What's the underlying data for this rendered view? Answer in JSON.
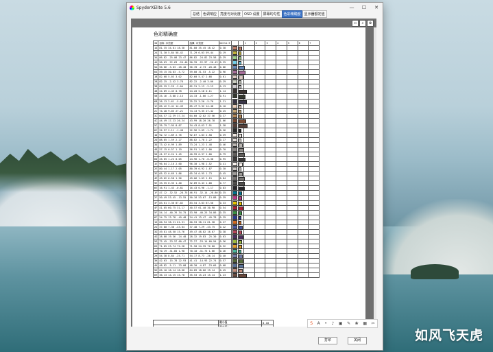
{
  "window": {
    "title": "SpyderXElite 5.6",
    "controls": [
      "—",
      "☐",
      "✕"
    ]
  },
  "tabs": [
    "总结",
    "色调响应",
    "亮度与对比度",
    "OSD 设置",
    "屏幕均匀性",
    "色彩精确度",
    "显示器额定值"
  ],
  "active_tab": 5,
  "report": {
    "title": "色彩精确度",
    "headers": [
      "ID",
      "目标 示范室",
      "结果 示范室",
      "Delta E",
      "",
      "",
      "1",
      "2",
      "3",
      "4",
      "5",
      "6",
      "7"
    ],
    "rows": [
      {
        "id": "1A",
        "target": "81.35  34.81  18.38",
        "result": "81.80  35.45  18.42",
        "de": "0.38",
        "color": "#c0806b",
        "bar": 0.05
      },
      {
        "id": "2A",
        "target": "71.30  5.84  58.42",
        "result": "71.29  6.03  59.44",
        "de": "0.19",
        "color": "#c1b13c",
        "bar": 0.03
      },
      {
        "id": "3A",
        "target": "86.82 -25.08  23.47",
        "result": "86.82 -24.82  23.58",
        "de": "0.29",
        "color": "#9ed08b",
        "bar": 0.04
      },
      {
        "id": "4A",
        "target": "90.63 -22.63 -26.40",
        "result": "90.39 -22.97 -26.43",
        "de": "0.25",
        "color": "#74d0e8",
        "bar": 0.04
      },
      {
        "id": "5A",
        "target": "56.66 -3.03 -28.40",
        "result": "56.78 -2.73 -28.48",
        "de": "0.86",
        "color": "#6a8ab7",
        "bar": 0.12
      },
      {
        "id": "6A",
        "target": "59.15  30.83 -5.72",
        "result": "59.00  31.53 -5.22",
        "de": "0.96",
        "color": "#a86f9b",
        "bar": 0.13
      },
      {
        "id": "1B",
        "target": "82.68  5.03  3.02",
        "result": "82.60  5.47  2.68",
        "de": "0.61",
        "color": "#dcc9c2",
        "bar": 0.09
      },
      {
        "id": "2B",
        "target": "82.25 -2.42  3.78",
        "result": "82.22 -2.40  3.06",
        "de": "0.29",
        "color": "#cccfc2",
        "bar": 0.04
      },
      {
        "id": "3B",
        "target": "82.29  2.29 -2.04",
        "result": "82.31  2.13 -2.13",
        "de": "0.13",
        "color": "#d0ccd0",
        "bar": 0.02
      },
      {
        "id": "4B",
        "target": "24.89  4.43  0.78",
        "result": "24.20  5.18  0.11",
        "de": "1.14",
        "color": "#3e3634",
        "bar": 0.16
      },
      {
        "id": "5B",
        "target": "25.16 -3.88  2.13",
        "result": "24.33 -1.66  1.27",
        "de": "0.91",
        "color": "#35392f",
        "bar": 0.13
      },
      {
        "id": "6B",
        "target": "26.13  2.61 -5.03",
        "result": "25.22  3.20 -5.70",
        "de": "1.21",
        "color": "#3a3648",
        "bar": 0.17
      },
      {
        "id": "1C",
        "target": "85.42  9.41  14.49",
        "result": "85.47  9.32  14.48",
        "de": "0.10",
        "color": "#e8cdb8",
        "bar": 0.02
      },
      {
        "id": "2C",
        "target": "74.28  9.05  27.21",
        "result": "74.13  9.35  27.42",
        "de": "0.25",
        "color": "#c7a878",
        "bar": 0.04
      },
      {
        "id": "3C",
        "target": "64.57  12.39  37.24",
        "result": "64.60  12.02  37.56",
        "de": "0.37",
        "color": "#b78a5a",
        "bar": 0.05
      },
      {
        "id": "4C",
        "target": "44.49  17.23  26.24",
        "result": "43.99  18.20  26.78",
        "de": "1.06",
        "color": "#7a4a34",
        "bar": 0.15
      },
      {
        "id": "5C",
        "target": "35.79  7.95  8.87",
        "result": "34.43  8.63  7.91",
        "de": "1.38",
        "color": "#56403a",
        "bar": 0.19
      },
      {
        "id": "6C",
        "target": "22.97  2.11 -1.48",
        "result": "22.96  2.09 -1.74",
        "de": "0.26",
        "color": "#2c2b2c",
        "bar": 0.04
      },
      {
        "id": "1D",
        "target": "92.72  1.89  2.76",
        "result": "92.67  1.83  2.58",
        "de": "0.39",
        "color": "#efe8e3",
        "bar": 0.05
      },
      {
        "id": "2D",
        "target": "88.85  1.59  2.27",
        "result": "88.82  1.78  2.22",
        "de": "0.27",
        "color": "#e2ddd9",
        "bar": 0.04
      },
      {
        "id": "3D",
        "target": "73.42  0.99  1.89",
        "result": "73.24  1.23  1.48",
        "de": "0.46",
        "color": "#bcb7b3",
        "bar": 0.07
      },
      {
        "id": "4D",
        "target": "57.15  0.57  1.19",
        "result": "56.91  1.02  1.00",
        "de": "0.70",
        "color": "#8d8986",
        "bar": 0.1
      },
      {
        "id": "5D",
        "target": "41.57  0.24  1.45",
        "result": "40.99  0.37  1.00",
        "de": "0.79",
        "color": "#625f5d",
        "bar": 0.11
      },
      {
        "id": "6D",
        "target": "25.65  1.24  0.05",
        "result": "24.96  1.70 -0.38",
        "de": "0.95",
        "color": "#3c3a3a",
        "bar": 0.13
      },
      {
        "id": "1E",
        "target": "96.04  2.16  2.60",
        "result": "96.30  1.98  2.52",
        "de": "0.41",
        "color": "#faf3ee",
        "bar": 0.06
      },
      {
        "id": "2E",
        "target": "80.44  1.17  2.05",
        "result": "80.39  0.92  1.87",
        "de": "0.30",
        "color": "#cbc7c3",
        "bar": 0.04
      },
      {
        "id": "3E",
        "target": "65.52  0.69  1.86",
        "result": "65.34  0.95  1.73",
        "de": "0.45",
        "color": "#a09d9a",
        "bar": 0.06
      },
      {
        "id": "4E",
        "target": "49.62  0.58  1.56",
        "result": "49.06  1.03  1.15",
        "de": "0.84",
        "color": "#777472",
        "bar": 0.12
      },
      {
        "id": "5E",
        "target": "33.55  0.35  1.40",
        "result": "32.89  0.43  1.00",
        "de": "0.77",
        "color": "#514f4d",
        "bar": 0.11
      },
      {
        "id": "6E",
        "target": "16.91  1.43 -0.81",
        "result": "16.43  0.96 -1.17",
        "de": "0.83",
        "color": "#282629",
        "bar": 0.12
      },
      {
        "id": "1F",
        "target": "47.12 -32.52 -28.75",
        "result": "46.91 -32.14 -28.80",
        "de": "0.35",
        "color": "#00748f",
        "bar": 0.05
      },
      {
        "id": "2F",
        "target": "50.49  53.45 -13.55",
        "result": "50.18  53.67 -13.88",
        "de": "0.39",
        "color": "#bb3a8a",
        "bar": 0.05
      },
      {
        "id": "3F",
        "target": "83.61  3.36  87.02",
        "result": "83.54  3.83  87.50",
        "de": "0.33",
        "color": "#e8c600",
        "bar": 0.05
      },
      {
        "id": "4F",
        "target": "41.05  60.75  31.17",
        "result": "40.57  61.40  30.90",
        "de": "0.54",
        "color": "#ad2237",
        "bar": 0.08
      },
      {
        "id": "5F",
        "target": "54.14 -40.76  34.75",
        "result": "53.90 -40.25  34.86",
        "de": "0.35",
        "color": "#3b9244",
        "bar": 0.05
      },
      {
        "id": "6F",
        "target": "24.75  13.78 -49.48",
        "result": "24.41  13.47 -49.78",
        "de": "0.29",
        "color": "#2c3a8c",
        "bar": 0.04
      },
      {
        "id": "1G",
        "target": "60.94  38.21  61.31",
        "result": "60.53  38.11  61.38",
        "de": "0.27",
        "color": "#d46b1f",
        "bar": 0.04
      },
      {
        "id": "2G",
        "target": "37.80  7.30 -43.04",
        "result": "37.48  7.29 -43.75",
        "de": "0.42",
        "color": "#4c5aa3",
        "bar": 0.06
      },
      {
        "id": "3G",
        "target": "49.81  48.50  15.76",
        "result": "49.47  48.82  16.07",
        "de": "0.38",
        "color": "#b9475c",
        "bar": 0.05
      },
      {
        "id": "4G",
        "target": "28.88  19.36 -24.48",
        "result": "28.32  19.83 -25.30",
        "de": "0.63",
        "color": "#4e2f60",
        "bar": 0.09
      },
      {
        "id": "5G",
        "target": "72.45 -23.57  60.47",
        "result": "72.27 -23.14  60.94",
        "de": "0.36",
        "color": "#9dbb3e",
        "bar": 0.05
      },
      {
        "id": "6G",
        "target": "71.65  23.74  72.28",
        "result": "71.50  24.35  72.60",
        "de": "0.32",
        "color": "#e29e2e",
        "bar": 0.05
      },
      {
        "id": "1H",
        "target": "70.19 -31.85  1.98",
        "result": "70.10 -31.75  1.66",
        "de": "0.26",
        "color": "#4ab79a",
        "bar": 0.04
      },
      {
        "id": "2H",
        "target": "54.38  8.84 -25.71",
        "result": "54.17  8.73 -26.14",
        "de": "0.40",
        "color": "#777fac",
        "bar": 0.06
      },
      {
        "id": "3H",
        "target": "42.03 -15.78  22.93",
        "result": "41.41 -14.93  22.74",
        "de": "0.57",
        "color": "#556a3a",
        "bar": 0.08
      },
      {
        "id": "4H",
        "target": "48.82 -5.11 -23.08",
        "result": "48.30 -4.87 -23.66",
        "de": "0.68",
        "color": "#5b7398",
        "bar": 0.1
      },
      {
        "id": "5H",
        "target": "65.10  18.14  18.68",
        "result": "64.89  18.66  19.14",
        "de": "0.45",
        "color": "#c28e7c",
        "bar": 0.06
      },
      {
        "id": "6H",
        "target": "36.13  14.15  15.78",
        "result": "35.53  15.23  15.14",
        "de": "1.23",
        "color": "#6a4a3d",
        "bar": 0.17
      }
    ],
    "summary": [
      {
        "label": "最小值",
        "value": "0.10"
      },
      {
        "label": "最大值：",
        "value": "1.38"
      },
      {
        "label": "平均值：",
        "value": "0.54"
      }
    ]
  },
  "toolbar": {
    "items": [
      "S",
      "A",
      "•",
      "♪",
      "▣",
      "✎",
      "❀",
      "▦",
      "✂"
    ]
  },
  "buttons": {
    "print": "打印",
    "close": "关闭"
  },
  "watermark": "如风飞天虎"
}
